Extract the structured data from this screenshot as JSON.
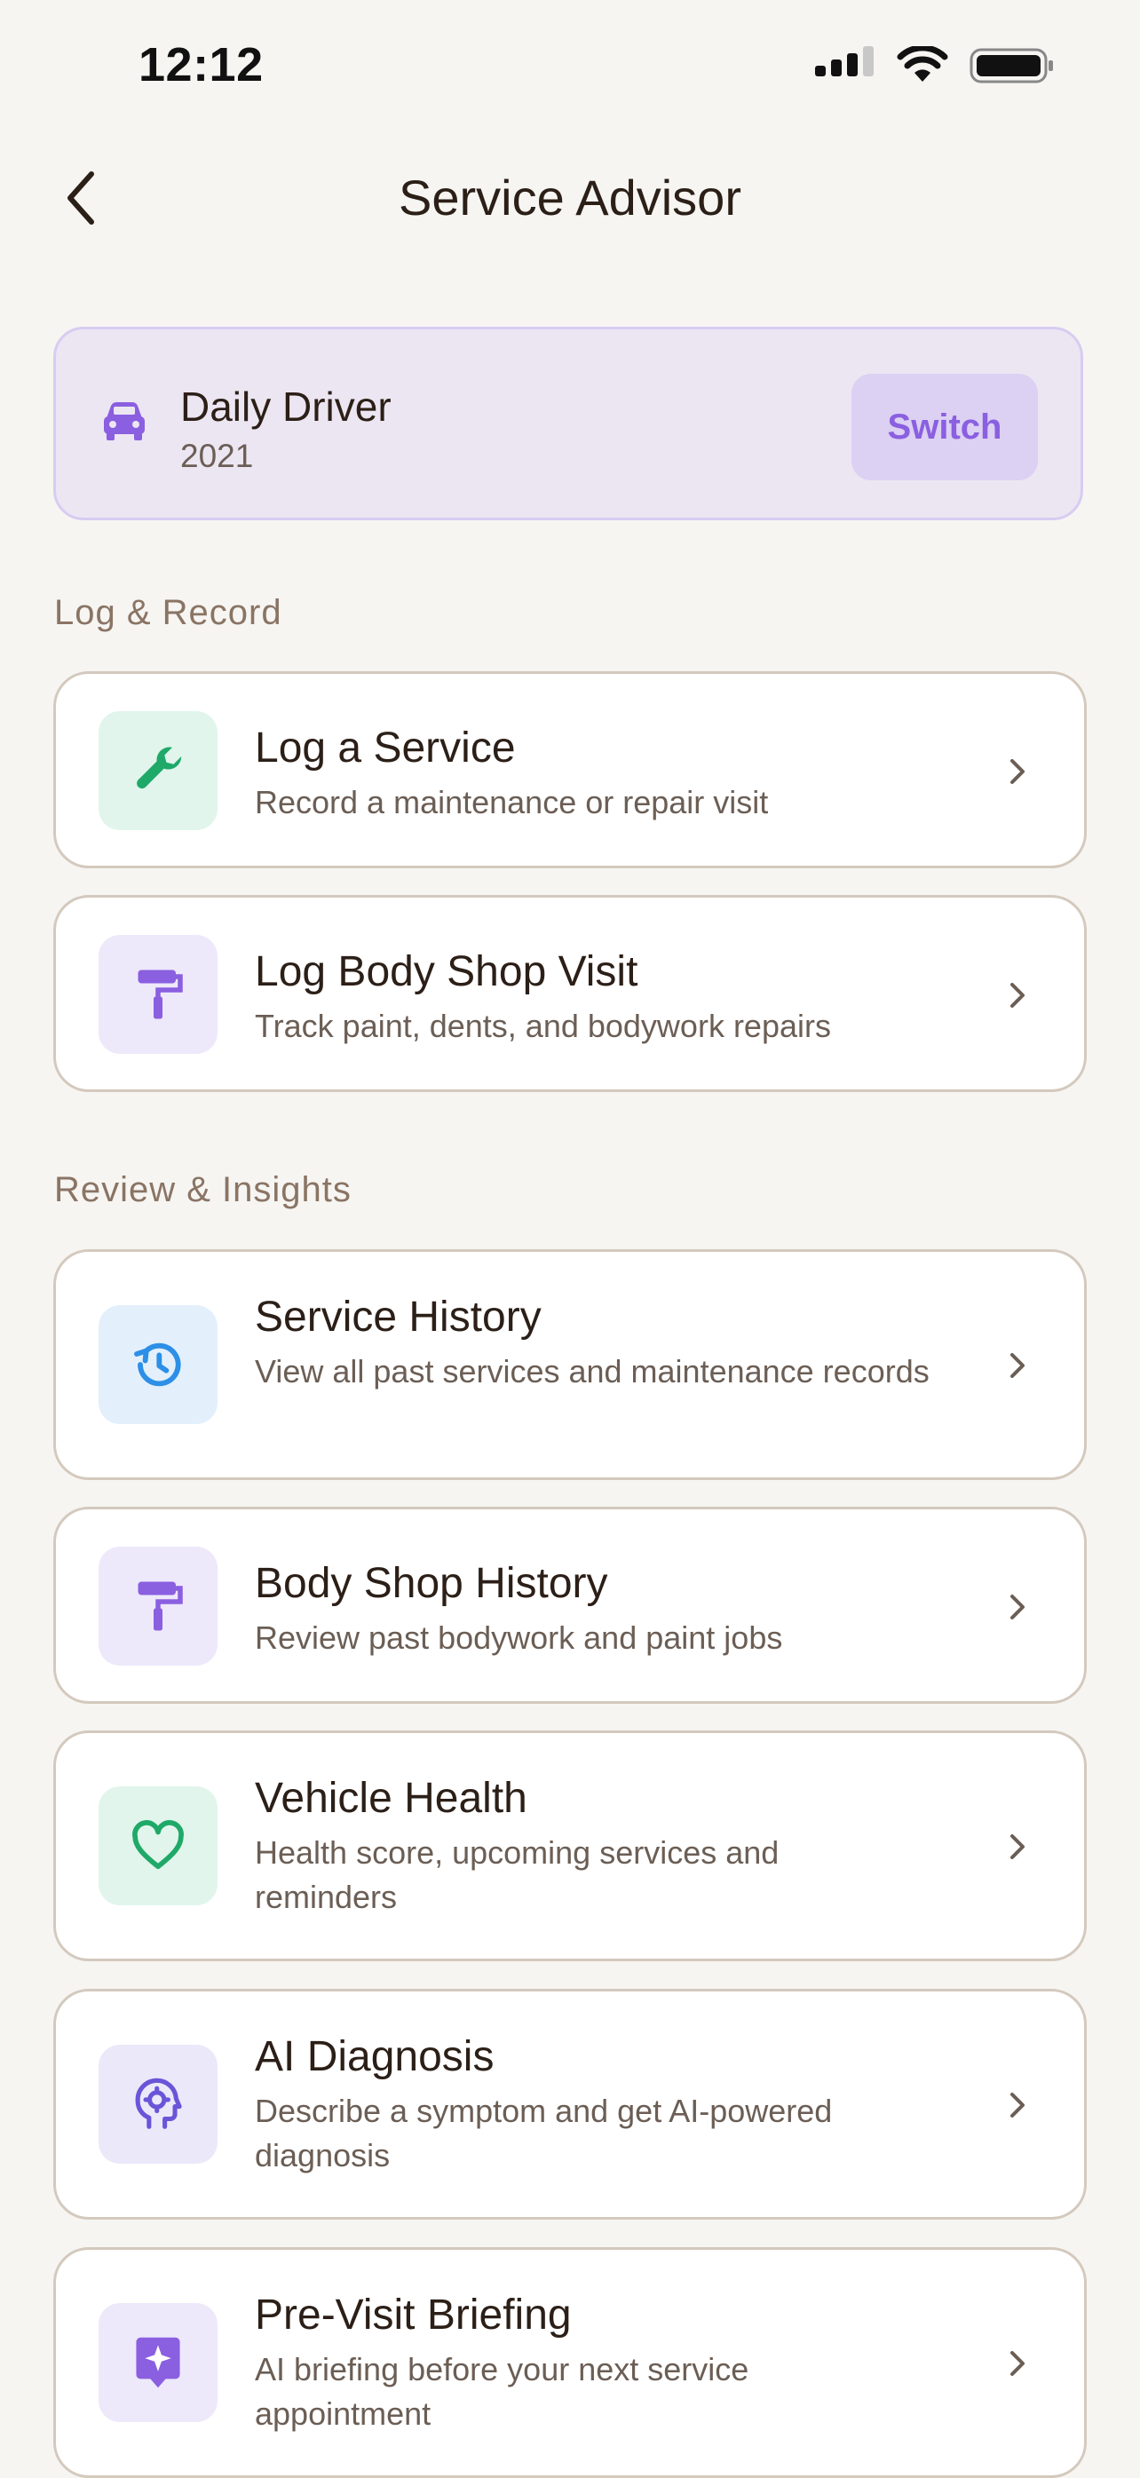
{
  "status": {
    "time": "12:12"
  },
  "nav": {
    "title": "Service Advisor"
  },
  "vehicle": {
    "name": "Daily Driver",
    "year": "2021",
    "switch_label": "Switch"
  },
  "sections": [
    {
      "label": "Log & Record"
    },
    {
      "label": "Review & Insights"
    }
  ],
  "items": [
    {
      "title": "Log a Service",
      "subtitle": "Record a maintenance or repair visit",
      "icon": "wrench-icon"
    },
    {
      "title": "Log Body Shop Visit",
      "subtitle": "Track paint, dents, and bodywork repairs",
      "icon": "paint-roller-icon"
    },
    {
      "title": "Service History",
      "subtitle": "View all past services and maintenance records",
      "icon": "history-icon"
    },
    {
      "title": "Body Shop History",
      "subtitle": "Review past bodywork and paint jobs",
      "icon": "paint-roller-icon"
    },
    {
      "title": "Vehicle Health",
      "subtitle": "Health score, upcoming services and reminders",
      "icon": "heart-icon"
    },
    {
      "title": "AI Diagnosis",
      "subtitle": "Describe a symptom and get AI-powered diagnosis",
      "icon": "brain-gear-icon"
    },
    {
      "title": "Pre-Visit Briefing",
      "subtitle": "AI briefing before your next service appointment",
      "icon": "sparkle-badge-icon"
    }
  ],
  "colors": {
    "background": "#f6f5f2",
    "accent_purple": "#8a5fe0",
    "vehicle_card": "#ece6f2",
    "green_icon": "#1fa968",
    "blue_icon": "#2d8fe6"
  }
}
